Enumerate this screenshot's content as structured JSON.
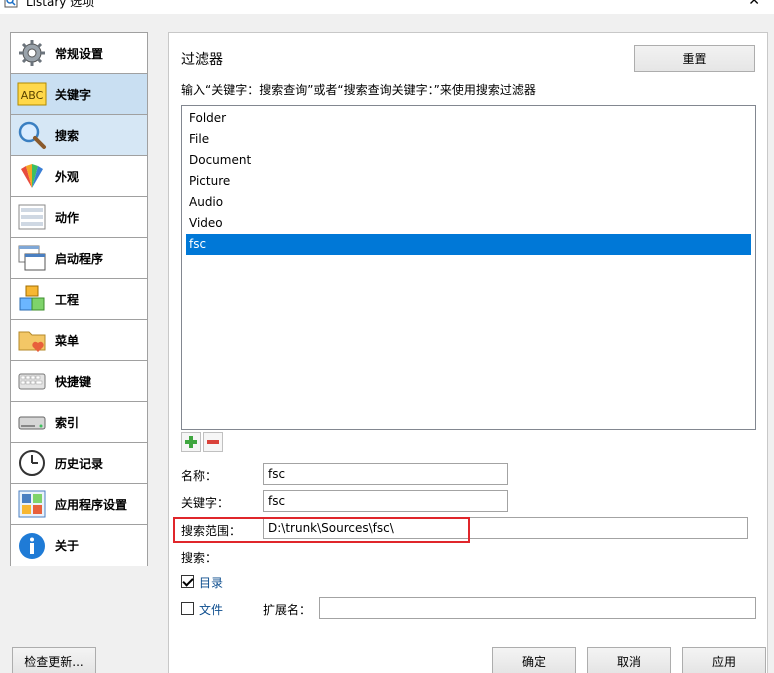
{
  "window": {
    "title": "Listary 选项",
    "close_glyph": "✕"
  },
  "sidebar": {
    "items": [
      {
        "label": "常规设置",
        "icon": "gear-icon"
      },
      {
        "label": "关键字",
        "icon": "abc-icon",
        "selected": true
      },
      {
        "label": "搜索",
        "icon": "magnifier-icon"
      },
      {
        "label": "外观",
        "icon": "palette-icon"
      },
      {
        "label": "动作",
        "icon": "actions-list-icon"
      },
      {
        "label": "启动程序",
        "icon": "windows-stack-icon"
      },
      {
        "label": "工程",
        "icon": "cubes-icon"
      },
      {
        "label": "菜单",
        "icon": "folder-heart-icon"
      },
      {
        "label": "快捷键",
        "icon": "keyboard-icon"
      },
      {
        "label": "索引",
        "icon": "drive-icon"
      },
      {
        "label": "历史记录",
        "icon": "clock-icon"
      },
      {
        "label": "应用程序设置",
        "icon": "app-grid-icon"
      },
      {
        "label": "关于",
        "icon": "info-icon"
      }
    ]
  },
  "main": {
    "section_title": "过滤器",
    "reset_label": "重置",
    "hint": "输入“关键字：搜索查询”或者“搜索查询关键字：”来使用搜索过滤器",
    "filters": [
      "Folder",
      "File",
      "Document",
      "Picture",
      "Audio",
      "Video",
      "fsc"
    ],
    "selected_filter": "fsc",
    "form": {
      "name_label": "名称：",
      "name_value": "fsc",
      "keyword_label": "关键字：",
      "keyword_value": "fsc",
      "scope_label": "搜索范围：",
      "scope_value": "D:\\trunk\\Sources\\fsc\\",
      "search_label": "搜索：",
      "dir_label": "目录",
      "dir_checked": true,
      "file_label": "文件",
      "file_checked": false,
      "ext_label": "扩展名：",
      "ext_value": ""
    }
  },
  "footer": {
    "check_update": "检查更新...",
    "ok": "确定",
    "cancel": "取消",
    "apply": "应用"
  },
  "colors": {
    "selection_blue": "#0078d7",
    "sidebar_selected": "#c9dff2",
    "highlight_red": "#e0262b"
  }
}
